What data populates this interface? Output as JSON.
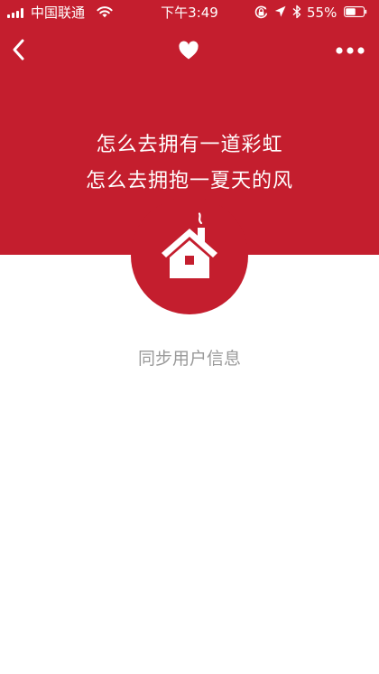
{
  "colors": {
    "accent": "#C41E2E",
    "muted_text": "#9A9A9A",
    "background": "#FFFFFF"
  },
  "status_bar": {
    "carrier": "中国联通",
    "time": "下午3:49",
    "battery_percent": "55%",
    "battery_level": 0.55,
    "icons": [
      "signal-icon",
      "wifi-icon",
      "orientation-lock-icon",
      "location-icon",
      "bluetooth-icon",
      "battery-icon"
    ]
  },
  "nav": {
    "icons": [
      "back-chevron-icon",
      "heart-icon",
      "more-dots-icon"
    ]
  },
  "hero": {
    "line1": "怎么去拥有一道彩虹",
    "line2": "怎么去拥抱一夏天的风",
    "icon": "house-icon"
  },
  "action": {
    "sync_label": "同步用户信息"
  }
}
